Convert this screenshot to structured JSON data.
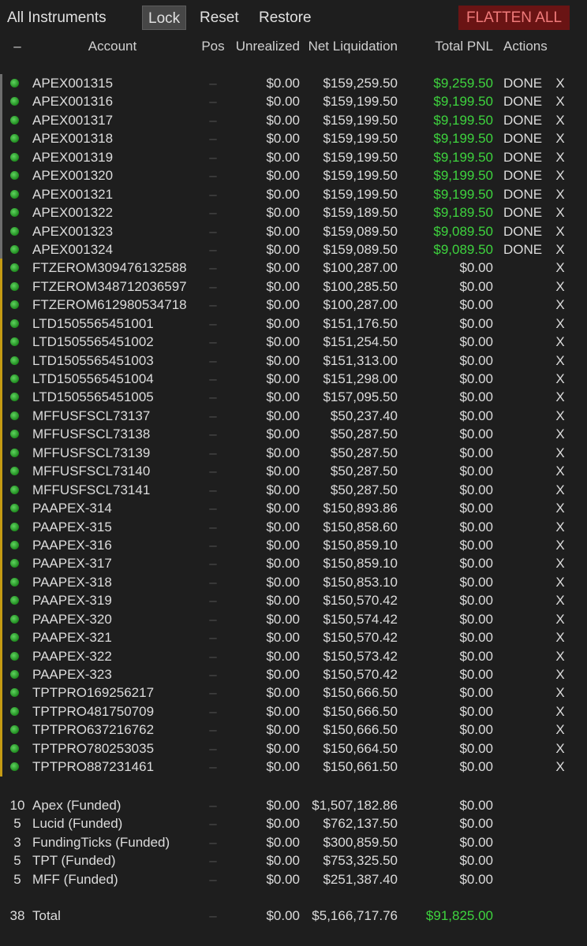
{
  "toolbar": {
    "title": "All Instruments",
    "lock": "Lock",
    "reset": "Reset",
    "restore": "Restore",
    "flatten": "FLATTEN ALL"
  },
  "header": {
    "dash": "–",
    "account": "Account",
    "pos": "Pos",
    "unrealized": "Unrealized",
    "net": "Net Liquidation",
    "pnl": "Total PNL",
    "actions": "Actions"
  },
  "colors": {
    "positive": "#3ed43e",
    "danger_bg": "#6a1414",
    "danger_fg": "#f07a7a",
    "apex_stripe": "#6e6e6e",
    "other_stripe": "#c59b14"
  },
  "rows": [
    {
      "account": "APEX001315",
      "pos": "–",
      "unrealized": "$0.00",
      "net": "$159,259.50",
      "pnl": "$9,259.50",
      "positive": true,
      "action": "DONE",
      "close": "X",
      "group": "gray"
    },
    {
      "account": "APEX001316",
      "pos": "–",
      "unrealized": "$0.00",
      "net": "$159,199.50",
      "pnl": "$9,199.50",
      "positive": true,
      "action": "DONE",
      "close": "X",
      "group": "gray"
    },
    {
      "account": "APEX001317",
      "pos": "–",
      "unrealized": "$0.00",
      "net": "$159,199.50",
      "pnl": "$9,199.50",
      "positive": true,
      "action": "DONE",
      "close": "X",
      "group": "gray"
    },
    {
      "account": "APEX001318",
      "pos": "–",
      "unrealized": "$0.00",
      "net": "$159,199.50",
      "pnl": "$9,199.50",
      "positive": true,
      "action": "DONE",
      "close": "X",
      "group": "gray"
    },
    {
      "account": "APEX001319",
      "pos": "–",
      "unrealized": "$0.00",
      "net": "$159,199.50",
      "pnl": "$9,199.50",
      "positive": true,
      "action": "DONE",
      "close": "X",
      "group": "gray"
    },
    {
      "account": "APEX001320",
      "pos": "–",
      "unrealized": "$0.00",
      "net": "$159,199.50",
      "pnl": "$9,199.50",
      "positive": true,
      "action": "DONE",
      "close": "X",
      "group": "gray"
    },
    {
      "account": "APEX001321",
      "pos": "–",
      "unrealized": "$0.00",
      "net": "$159,199.50",
      "pnl": "$9,199.50",
      "positive": true,
      "action": "DONE",
      "close": "X",
      "group": "gray"
    },
    {
      "account": "APEX001322",
      "pos": "–",
      "unrealized": "$0.00",
      "net": "$159,189.50",
      "pnl": "$9,189.50",
      "positive": true,
      "action": "DONE",
      "close": "X",
      "group": "gray"
    },
    {
      "account": "APEX001323",
      "pos": "–",
      "unrealized": "$0.00",
      "net": "$159,089.50",
      "pnl": "$9,089.50",
      "positive": true,
      "action": "DONE",
      "close": "X",
      "group": "gray"
    },
    {
      "account": "APEX001324",
      "pos": "–",
      "unrealized": "$0.00",
      "net": "$159,089.50",
      "pnl": "$9,089.50",
      "positive": true,
      "action": "DONE",
      "close": "X",
      "group": "gray"
    },
    {
      "account": "FTZEROM309476132588",
      "pos": "–",
      "unrealized": "$0.00",
      "net": "$100,287.00",
      "pnl": "$0.00",
      "positive": false,
      "action": "",
      "close": "X",
      "group": "gold"
    },
    {
      "account": "FTZEROM348712036597",
      "pos": "–",
      "unrealized": "$0.00",
      "net": "$100,285.50",
      "pnl": "$0.00",
      "positive": false,
      "action": "",
      "close": "X",
      "group": "gold"
    },
    {
      "account": "FTZEROM612980534718",
      "pos": "–",
      "unrealized": "$0.00",
      "net": "$100,287.00",
      "pnl": "$0.00",
      "positive": false,
      "action": "",
      "close": "X",
      "group": "gold"
    },
    {
      "account": "LTD1505565451001",
      "pos": "–",
      "unrealized": "$0.00",
      "net": "$151,176.50",
      "pnl": "$0.00",
      "positive": false,
      "action": "",
      "close": "X",
      "group": "gold"
    },
    {
      "account": "LTD1505565451002",
      "pos": "–",
      "unrealized": "$0.00",
      "net": "$151,254.50",
      "pnl": "$0.00",
      "positive": false,
      "action": "",
      "close": "X",
      "group": "gold"
    },
    {
      "account": "LTD1505565451003",
      "pos": "–",
      "unrealized": "$0.00",
      "net": "$151,313.00",
      "pnl": "$0.00",
      "positive": false,
      "action": "",
      "close": "X",
      "group": "gold"
    },
    {
      "account": "LTD1505565451004",
      "pos": "–",
      "unrealized": "$0.00",
      "net": "$151,298.00",
      "pnl": "$0.00",
      "positive": false,
      "action": "",
      "close": "X",
      "group": "gold"
    },
    {
      "account": "LTD1505565451005",
      "pos": "–",
      "unrealized": "$0.00",
      "net": "$157,095.50",
      "pnl": "$0.00",
      "positive": false,
      "action": "",
      "close": "X",
      "group": "gold"
    },
    {
      "account": "MFFUSFSCL73137",
      "pos": "–",
      "unrealized": "$0.00",
      "net": "$50,237.40",
      "pnl": "$0.00",
      "positive": false,
      "action": "",
      "close": "X",
      "group": "gold"
    },
    {
      "account": "MFFUSFSCL73138",
      "pos": "–",
      "unrealized": "$0.00",
      "net": "$50,287.50",
      "pnl": "$0.00",
      "positive": false,
      "action": "",
      "close": "X",
      "group": "gold"
    },
    {
      "account": "MFFUSFSCL73139",
      "pos": "–",
      "unrealized": "$0.00",
      "net": "$50,287.50",
      "pnl": "$0.00",
      "positive": false,
      "action": "",
      "close": "X",
      "group": "gold"
    },
    {
      "account": "MFFUSFSCL73140",
      "pos": "–",
      "unrealized": "$0.00",
      "net": "$50,287.50",
      "pnl": "$0.00",
      "positive": false,
      "action": "",
      "close": "X",
      "group": "gold"
    },
    {
      "account": "MFFUSFSCL73141",
      "pos": "–",
      "unrealized": "$0.00",
      "net": "$50,287.50",
      "pnl": "$0.00",
      "positive": false,
      "action": "",
      "close": "X",
      "group": "gold"
    },
    {
      "account": "PAAPEX-314",
      "pos": "–",
      "unrealized": "$0.00",
      "net": "$150,893.86",
      "pnl": "$0.00",
      "positive": false,
      "action": "",
      "close": "X",
      "group": "gold"
    },
    {
      "account": "PAAPEX-315",
      "pos": "–",
      "unrealized": "$0.00",
      "net": "$150,858.60",
      "pnl": "$0.00",
      "positive": false,
      "action": "",
      "close": "X",
      "group": "gold"
    },
    {
      "account": "PAAPEX-316",
      "pos": "–",
      "unrealized": "$0.00",
      "net": "$150,859.10",
      "pnl": "$0.00",
      "positive": false,
      "action": "",
      "close": "X",
      "group": "gold"
    },
    {
      "account": "PAAPEX-317",
      "pos": "–",
      "unrealized": "$0.00",
      "net": "$150,859.10",
      "pnl": "$0.00",
      "positive": false,
      "action": "",
      "close": "X",
      "group": "gold"
    },
    {
      "account": "PAAPEX-318",
      "pos": "–",
      "unrealized": "$0.00",
      "net": "$150,853.10",
      "pnl": "$0.00",
      "positive": false,
      "action": "",
      "close": "X",
      "group": "gold"
    },
    {
      "account": "PAAPEX-319",
      "pos": "–",
      "unrealized": "$0.00",
      "net": "$150,570.42",
      "pnl": "$0.00",
      "positive": false,
      "action": "",
      "close": "X",
      "group": "gold"
    },
    {
      "account": "PAAPEX-320",
      "pos": "–",
      "unrealized": "$0.00",
      "net": "$150,574.42",
      "pnl": "$0.00",
      "positive": false,
      "action": "",
      "close": "X",
      "group": "gold"
    },
    {
      "account": "PAAPEX-321",
      "pos": "–",
      "unrealized": "$0.00",
      "net": "$150,570.42",
      "pnl": "$0.00",
      "positive": false,
      "action": "",
      "close": "X",
      "group": "gold"
    },
    {
      "account": "PAAPEX-322",
      "pos": "–",
      "unrealized": "$0.00",
      "net": "$150,573.42",
      "pnl": "$0.00",
      "positive": false,
      "action": "",
      "close": "X",
      "group": "gold"
    },
    {
      "account": "PAAPEX-323",
      "pos": "–",
      "unrealized": "$0.00",
      "net": "$150,570.42",
      "pnl": "$0.00",
      "positive": false,
      "action": "",
      "close": "X",
      "group": "gold"
    },
    {
      "account": "TPTPRO169256217",
      "pos": "–",
      "unrealized": "$0.00",
      "net": "$150,666.50",
      "pnl": "$0.00",
      "positive": false,
      "action": "",
      "close": "X",
      "group": "gold"
    },
    {
      "account": "TPTPRO481750709",
      "pos": "–",
      "unrealized": "$0.00",
      "net": "$150,666.50",
      "pnl": "$0.00",
      "positive": false,
      "action": "",
      "close": "X",
      "group": "gold"
    },
    {
      "account": "TPTPRO637216762",
      "pos": "–",
      "unrealized": "$0.00",
      "net": "$150,666.50",
      "pnl": "$0.00",
      "positive": false,
      "action": "",
      "close": "X",
      "group": "gold"
    },
    {
      "account": "TPTPRO780253035",
      "pos": "–",
      "unrealized": "$0.00",
      "net": "$150,664.50",
      "pnl": "$0.00",
      "positive": false,
      "action": "",
      "close": "X",
      "group": "gold"
    },
    {
      "account": "TPTPRO887231461",
      "pos": "–",
      "unrealized": "$0.00",
      "net": "$150,661.50",
      "pnl": "$0.00",
      "positive": false,
      "action": "",
      "close": "X",
      "group": "gold"
    }
  ],
  "summary": [
    {
      "count": "10",
      "name": "Apex (Funded)",
      "pos": "–",
      "unrealized": "$0.00",
      "net": "$1,507,182.86",
      "pnl": "$0.00"
    },
    {
      "count": "5",
      "name": "Lucid (Funded)",
      "pos": "–",
      "unrealized": "$0.00",
      "net": "$762,137.50",
      "pnl": "$0.00"
    },
    {
      "count": "3",
      "name": "FundingTicks (Funded)",
      "pos": "–",
      "unrealized": "$0.00",
      "net": "$300,859.50",
      "pnl": "$0.00"
    },
    {
      "count": "5",
      "name": "TPT (Funded)",
      "pos": "–",
      "unrealized": "$0.00",
      "net": "$753,325.50",
      "pnl": "$0.00"
    },
    {
      "count": "5",
      "name": "MFF (Funded)",
      "pos": "–",
      "unrealized": "$0.00",
      "net": "$251,387.40",
      "pnl": "$0.00"
    }
  ],
  "total": {
    "count": "38",
    "name": "Total",
    "pos": "–",
    "unrealized": "$0.00",
    "net": "$5,166,717.76",
    "pnl": "$91,825.00"
  }
}
